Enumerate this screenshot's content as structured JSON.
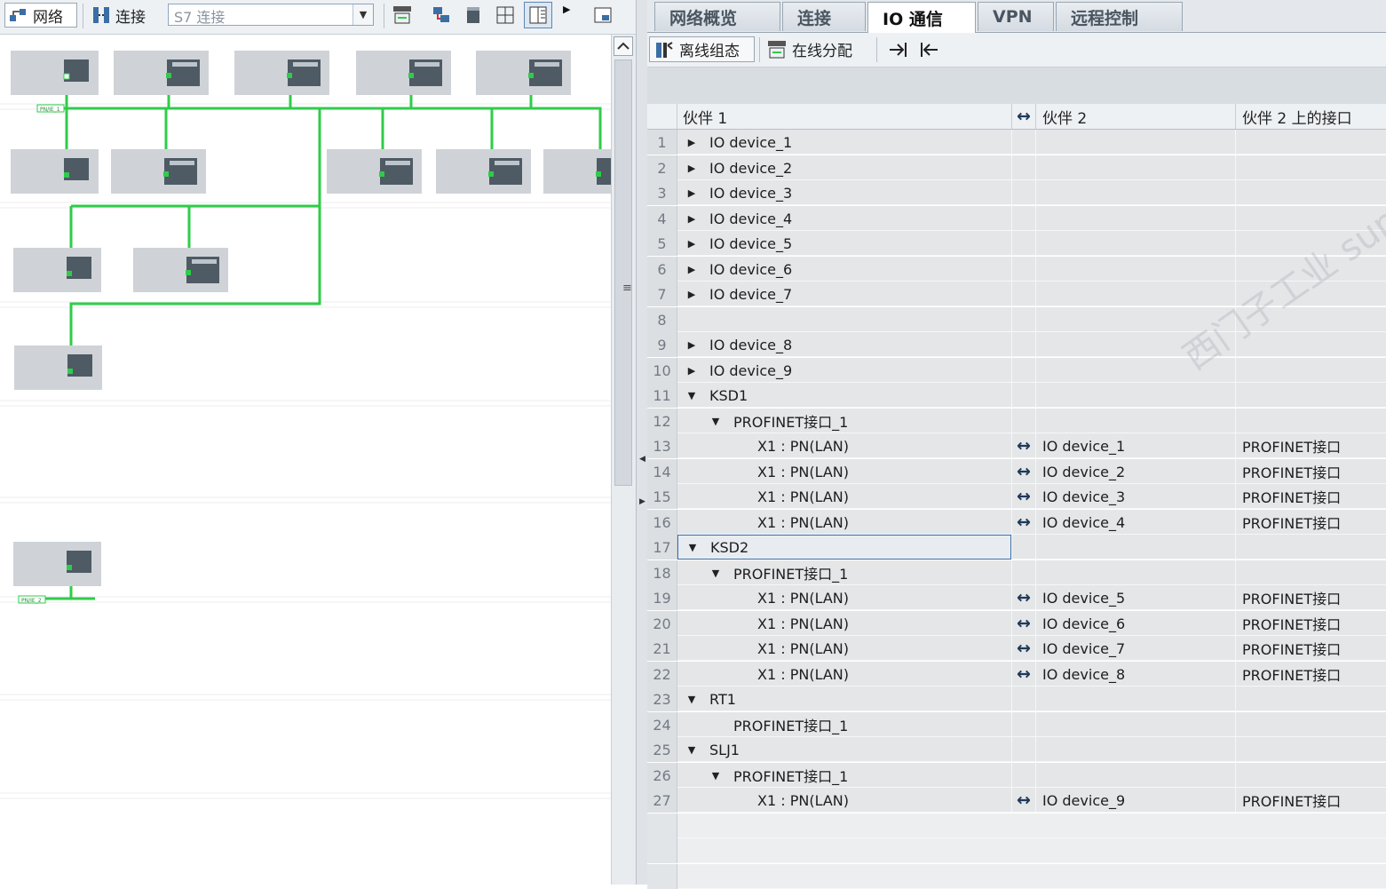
{
  "left_toolbar": {
    "network_label": "网络",
    "connection_label": "连接",
    "connection_type": "S7 连接"
  },
  "canvas": {
    "subnet_labels": [
      "PN/IE_1",
      "PN/IE_2"
    ]
  },
  "tabs": [
    {
      "label": "网络概览",
      "active": false
    },
    {
      "label": "连接",
      "active": false
    },
    {
      "label": "IO 通信",
      "active": true
    },
    {
      "label": "VPN",
      "active": false
    },
    {
      "label": "远程控制",
      "active": false
    }
  ],
  "sub_toolbar": {
    "offline_label": "离线组态",
    "online_label": "在线分配"
  },
  "table": {
    "headers": {
      "partner1": "伙伴 1",
      "partner2": "伙伴 2",
      "partner2_interface": "伙伴 2 上的接口"
    },
    "rows": [
      {
        "num": "1",
        "indent": 0,
        "expander": "collapsed",
        "partner1": "IO device_1",
        "arrow": "",
        "partner2": "",
        "interface": ""
      },
      {
        "num": "2",
        "indent": 0,
        "expander": "collapsed",
        "partner1": "IO device_2",
        "arrow": "",
        "partner2": "",
        "interface": ""
      },
      {
        "num": "3",
        "indent": 0,
        "expander": "collapsed",
        "partner1": "IO device_3",
        "arrow": "",
        "partner2": "",
        "interface": ""
      },
      {
        "num": "4",
        "indent": 0,
        "expander": "collapsed",
        "partner1": "IO device_4",
        "arrow": "",
        "partner2": "",
        "interface": ""
      },
      {
        "num": "5",
        "indent": 0,
        "expander": "collapsed",
        "partner1": "IO device_5",
        "arrow": "",
        "partner2": "",
        "interface": ""
      },
      {
        "num": "6",
        "indent": 0,
        "expander": "collapsed",
        "partner1": "IO device_6",
        "arrow": "",
        "partner2": "",
        "interface": ""
      },
      {
        "num": "7",
        "indent": 0,
        "expander": "collapsed",
        "partner1": "IO device_7",
        "arrow": "",
        "partner2": "",
        "interface": ""
      },
      {
        "num": "8",
        "indent": 0,
        "expander": "none",
        "partner1": "",
        "arrow": "",
        "partner2": "",
        "interface": ""
      },
      {
        "num": "9",
        "indent": 0,
        "expander": "collapsed",
        "partner1": "IO device_8",
        "arrow": "",
        "partner2": "",
        "interface": ""
      },
      {
        "num": "10",
        "indent": 0,
        "expander": "collapsed",
        "partner1": "IO device_9",
        "arrow": "",
        "partner2": "",
        "interface": ""
      },
      {
        "num": "11",
        "indent": 0,
        "expander": "expanded",
        "partner1": "KSD1",
        "arrow": "",
        "partner2": "",
        "interface": ""
      },
      {
        "num": "12",
        "indent": 1,
        "expander": "expanded",
        "partner1": "PROFINET接口_1",
        "arrow": "",
        "partner2": "",
        "interface": ""
      },
      {
        "num": "13",
        "indent": 2,
        "expander": "none",
        "partner1": "X1 : PN(LAN)",
        "arrow": "↔",
        "partner2": "IO device_1",
        "interface": "PROFINET接口"
      },
      {
        "num": "14",
        "indent": 2,
        "expander": "none",
        "partner1": "X1 : PN(LAN)",
        "arrow": "↔",
        "partner2": "IO device_2",
        "interface": "PROFINET接口"
      },
      {
        "num": "15",
        "indent": 2,
        "expander": "none",
        "partner1": "X1 : PN(LAN)",
        "arrow": "↔",
        "partner2": "IO device_3",
        "interface": "PROFINET接口"
      },
      {
        "num": "16",
        "indent": 2,
        "expander": "none",
        "partner1": "X1 : PN(LAN)",
        "arrow": "↔",
        "partner2": "IO device_4",
        "interface": "PROFINET接口"
      },
      {
        "num": "17",
        "indent": 0,
        "expander": "expanded",
        "partner1": "KSD2",
        "arrow": "",
        "partner2": "",
        "interface": "",
        "selected": true
      },
      {
        "num": "18",
        "indent": 1,
        "expander": "expanded",
        "partner1": "PROFINET接口_1",
        "arrow": "",
        "partner2": "",
        "interface": ""
      },
      {
        "num": "19",
        "indent": 2,
        "expander": "none",
        "partner1": "X1 : PN(LAN)",
        "arrow": "↔",
        "partner2": "IO device_5",
        "interface": "PROFINET接口"
      },
      {
        "num": "20",
        "indent": 2,
        "expander": "none",
        "partner1": "X1 : PN(LAN)",
        "arrow": "↔",
        "partner2": "IO device_6",
        "interface": "PROFINET接口"
      },
      {
        "num": "21",
        "indent": 2,
        "expander": "none",
        "partner1": "X1 : PN(LAN)",
        "arrow": "↔",
        "partner2": "IO device_7",
        "interface": "PROFINET接口"
      },
      {
        "num": "22",
        "indent": 2,
        "expander": "none",
        "partner1": "X1 : PN(LAN)",
        "arrow": "↔",
        "partner2": "IO device_8",
        "interface": "PROFINET接口"
      },
      {
        "num": "23",
        "indent": 0,
        "expander": "expanded",
        "partner1": "RT1",
        "arrow": "",
        "partner2": "",
        "interface": ""
      },
      {
        "num": "24",
        "indent": 1,
        "expander": "none",
        "partner1": "PROFINET接口_1",
        "arrow": "",
        "partner2": "",
        "interface": ""
      },
      {
        "num": "25",
        "indent": 0,
        "expander": "expanded",
        "partner1": "SLJ1",
        "arrow": "",
        "partner2": "",
        "interface": ""
      },
      {
        "num": "26",
        "indent": 1,
        "expander": "expanded",
        "partner1": "PROFINET接口_1",
        "arrow": "",
        "partner2": "",
        "interface": ""
      },
      {
        "num": "27",
        "indent": 2,
        "expander": "none",
        "partner1": "X1 : PN(LAN)",
        "arrow": "↔",
        "partner2": "IO device_9",
        "interface": "PROFINET接口"
      }
    ]
  },
  "watermark": "西门子工业 support.industry.siemens.com/cs",
  "colors": {
    "network_green": "#2fcc4a",
    "device_gray": "#cfd3d8",
    "module_dark": "#4e5a64"
  }
}
